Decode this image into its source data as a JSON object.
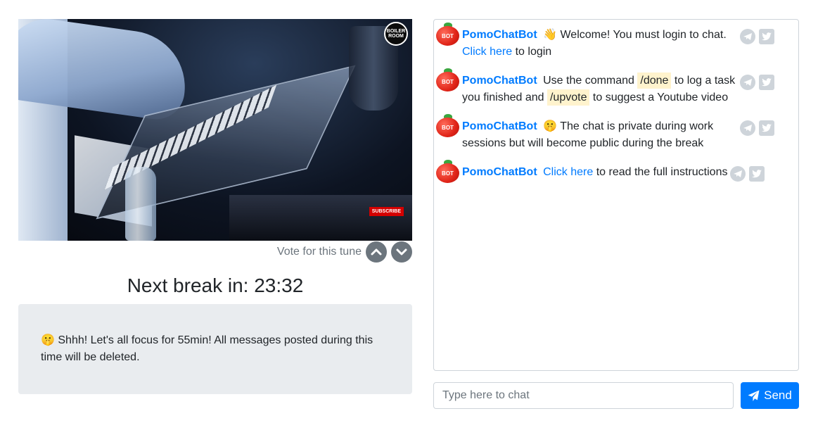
{
  "video": {
    "logo_text": "BOILER ROOM",
    "subscribe_label": "SUBSCRIBE"
  },
  "vote": {
    "label": "Vote for this tune"
  },
  "countdown": {
    "text": "Next break in: 23:32"
  },
  "alert": {
    "emoji": "🤫",
    "text": "Shhh! Let's all focus for 55min! All messages posted during this time will be deleted."
  },
  "chat": {
    "messages": [
      {
        "author": "PomoChatBot",
        "avatar_label": "BOT",
        "part1": "👋 Welcome! You must login to chat.",
        "link": "Click here",
        "part2": "to login"
      },
      {
        "author": "PomoChatBot",
        "avatar_label": "BOT",
        "part1": "Use the command",
        "cmd1": "/done",
        "part2": "to log a task you finished and",
        "cmd2": "/upvote",
        "part3": "to suggest a Youtube video"
      },
      {
        "author": "PomoChatBot",
        "avatar_label": "BOT",
        "part1": "🤫 The chat is private during work sessions but will become public during the break"
      },
      {
        "author": "PomoChatBot",
        "avatar_label": "BOT",
        "link": "Click here",
        "part1": "to read the full instructions"
      }
    ],
    "input_placeholder": "Type here to chat",
    "send_label": "Send"
  },
  "colors": {
    "primary": "#007bff",
    "muted": "#6c757d",
    "alert_bg": "#e9ecef",
    "command_bg": "#fff3cd"
  }
}
